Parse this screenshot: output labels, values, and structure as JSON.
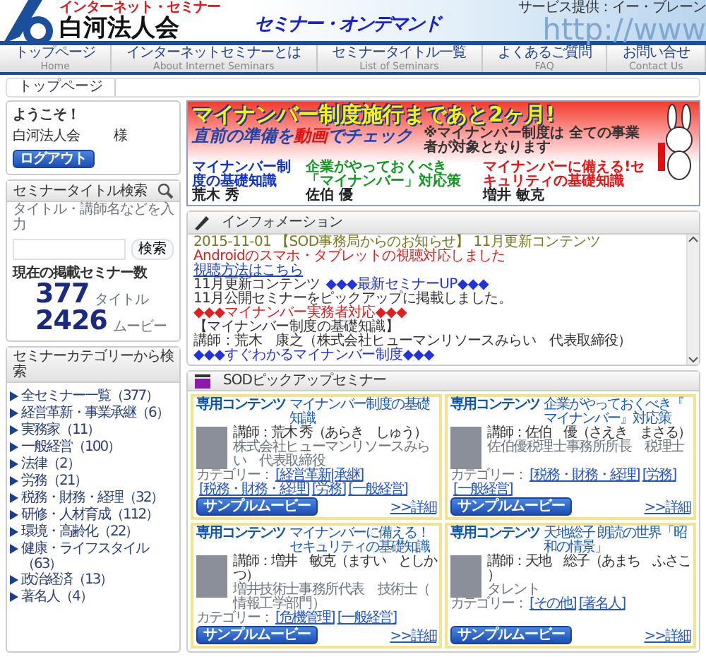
{
  "header": {
    "tagline": "インターネット・セミナー",
    "org_name": "白河法人会",
    "service_title": "セミナー・オンデマンド",
    "decor_text": "http://www",
    "provider": "サービス提供：イー・ブレーン"
  },
  "nav": [
    {
      "label": "トップページ",
      "sub": "Home"
    },
    {
      "label": "インターネットセミナーとは",
      "sub": "About Internet Seminars"
    },
    {
      "label": "セミナータイトル一覧",
      "sub": "List of Seminars"
    },
    {
      "label": "よくあるご質問",
      "sub": "FAQ"
    },
    {
      "label": "お問い合せ",
      "sub": "Contact Us"
    }
  ],
  "breadcrumb": [
    "トップページ"
  ],
  "welcome": {
    "greeting": "ようこそ！",
    "user": "白河法人会",
    "honorific": "様",
    "logout": "ログアウト"
  },
  "title_search": {
    "heading": "セミナータイトル検索",
    "label": "タイトル・講師名などを入力",
    "button": "検索",
    "count_heading": "現在の掲載セミナー数",
    "counts": [
      {
        "number": "377",
        "unit": "タイトル"
      },
      {
        "number": "2426",
        "unit": "ムービー"
      }
    ]
  },
  "categories": {
    "heading": "セミナーカテゴリーから検索",
    "items": [
      "全セミナー一覧（377）",
      "経営革新・事業承継（6）",
      "実務家（11）",
      "一般経営（100）",
      "法律（2）",
      "労務（21）",
      "税務・財務・経理（32）",
      "研修・人材育成（112）",
      "環境・高齢化（22）",
      "健康・ライフスタイル（63）",
      "政治経済（13）",
      "著名人（4）"
    ]
  },
  "banner": {
    "title": "マイナンバー制度施行まであと2ヶ月!",
    "subtitle": [
      {
        "text": "直前の準備を",
        "kind": "normal"
      },
      {
        "text": "動画",
        "kind": "accent"
      },
      {
        "text": "でチェック",
        "kind": "normal"
      }
    ],
    "note": "※マイナンバー制度は 全ての事業者が対象となります",
    "courses": [
      {
        "title": "マイナンバー制度の基礎知識",
        "lecturer": "荒木 秀",
        "color": "#1133cc"
      },
      {
        "title": "企業がやっておくべき「マイナンバー」対応策",
        "lecturer": "佐伯 優",
        "color": "#119922"
      },
      {
        "title": "マイナンバーに備える!セキュリティの基礎知識",
        "lecturer": "増井 敏克",
        "color": "#ee1111"
      }
    ]
  },
  "information": {
    "heading": "インフォメーション",
    "lines": [
      {
        "segments": [
          {
            "text": "2015-11-01 【SOD事務局からのお知らせ】 11月更新コンテンツ",
            "kind": "date"
          }
        ]
      },
      {
        "segments": [
          {
            "text": "Androidのスマホ・タブレットの視聴対応しました",
            "kind": "alert"
          }
        ]
      },
      {
        "segments": [
          {
            "text": "視聴方法はこちら",
            "kind": "link"
          }
        ]
      },
      {
        "segments": [
          {
            "text": "11月更新コンテンツ",
            "kind": "plain"
          },
          {
            "text": "◆◆◆最新セミナーUP◆◆◆",
            "kind": "highlight"
          }
        ]
      },
      {
        "segments": [
          {
            "text": "11月公開セミナーをピックアップに掲載しました。",
            "kind": "plain"
          }
        ]
      },
      {
        "segments": [
          {
            "text": "◆◆◆マイナンバー実務者対応◆◆◆",
            "kind": "alert"
          }
        ]
      },
      {
        "segments": [
          {
            "text": "【マイナンバー制度の基礎知識】",
            "kind": "plain"
          }
        ]
      },
      {
        "segments": [
          {
            "text": "講師：荒木　康之（株式会社ヒューマンリソースみらい　代表取締役）",
            "kind": "plain"
          }
        ]
      },
      {
        "segments": [
          {
            "text": "◆◆◆すぐわかるマイナンバー制度◆◆◆",
            "kind": "highlight"
          }
        ]
      }
    ]
  },
  "pickup": {
    "heading": "SODピックアップセミナー",
    "cards": [
      {
        "badge": "専用コンテンツ",
        "title": "マイナンバー制度の基礎知識",
        "instructor": "講師：荒木 秀（あらき　しゅう）",
        "affiliation": "株式会社ヒューマンリソースみらい　代表取締役",
        "category_label": "カテゴリー：",
        "tags": [
          "[経営革新|承継]",
          "[税務・財務・経理]",
          "[労務]",
          "[一般経営]"
        ],
        "detail": ">>詳細",
        "button": "サンプルムービー"
      },
      {
        "badge": "専用コンテンツ",
        "title": "企業がやっておくべき『マイナンバー』対応策",
        "instructor": "講師：佐伯　優（さえき　まさる）",
        "affiliation": "佐伯優税理士事務所所長　税理士",
        "category_label": "カテゴリー：",
        "tags": [
          "[税務・財務・経理]",
          "[労務]",
          "[一般経営]"
        ],
        "detail": ">>詳細",
        "button": "サンプルムービー"
      },
      {
        "badge": "専用コンテンツ",
        "title": "マイナンバーに備える！セキュリティの基礎知識",
        "instructor": "講師：増井　敏克（ますい　としかつ）",
        "affiliation": "増井技術士事務所代表　技術士（情報工学部門）",
        "category_label": "カテゴリー：",
        "tags": [
          "[危機管理]",
          "[一般経営]"
        ],
        "detail": ">>詳細",
        "button": "サンプルムービー"
      },
      {
        "badge": "専用コンテンツ",
        "title": "天地総子 朗読の世界「昭和の情景」",
        "instructor": "講師：天地　総子（あまち　ふさこ）",
        "affiliation": "タレント",
        "category_label": "カテゴリー：",
        "tags": [
          "[その他]",
          "[著名人]"
        ],
        "detail": ">>詳細",
        "button": "サンプルムービー"
      }
    ]
  }
}
